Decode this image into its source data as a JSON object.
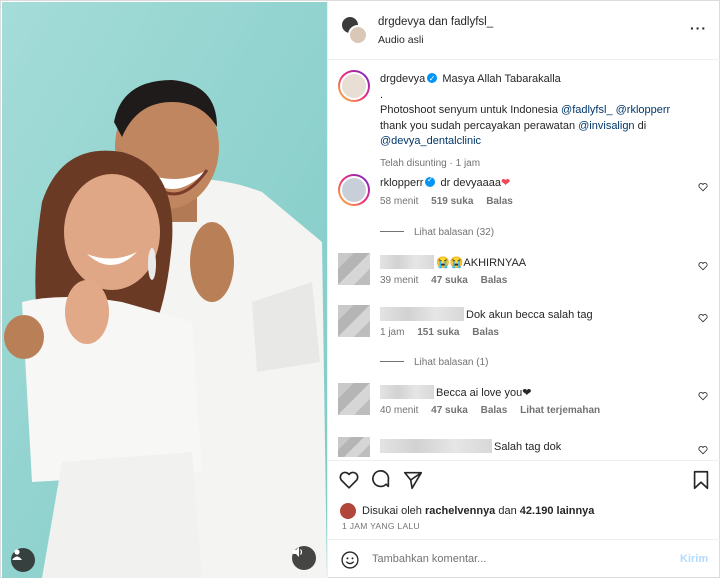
{
  "header": {
    "user1": "drgdevya",
    "joiner": "dan",
    "user2": "fadlyfsl_",
    "audio": "Audio asli",
    "more_icon": "more-icon"
  },
  "caption": {
    "username": "drgdevya",
    "line1": "Masya Allah Tabarakalla",
    "line2": ".",
    "line3_pre": "Photoshoot senyum untuk Indonesia",
    "mention1": "@fadlyfsl_",
    "mention2": "@rklopperr",
    "line4_pre": "thank you sudah percayakan perawatan",
    "mention3": "@invisalign",
    "line4_post": "di",
    "mention4": "@devya_dentalclinic",
    "meta": "Telah disunting · 1 jam"
  },
  "comments": [
    {
      "username": "rklopperr",
      "text": "dr devyaaaa",
      "time": "58 menit",
      "likes": "519 suka",
      "reply": "Balas"
    },
    {
      "text": "😭😭AKHIRNYAA",
      "time": "39 menit",
      "likes": "47 suka",
      "reply": "Balas"
    },
    {
      "text": "Dok akun becca salah tag",
      "time": "1 jam",
      "likes": "151 suka",
      "reply": "Balas"
    },
    {
      "text": "Becca ai love you",
      "time": "40 menit",
      "likes": "47 suka",
      "reply": "Balas",
      "translate": "Lihat terjemahan"
    },
    {
      "text": "Salah tag dok"
    }
  ],
  "view_replies_1": "Lihat balasan (32)",
  "view_replies_2": "Lihat balasan (1)",
  "likes": {
    "prefix": "Disukai oleh",
    "user": "rachelvennya",
    "mid": "dan",
    "count": "42.190",
    "suffix": "lainnya"
  },
  "time_ago": "1 JAM YANG LALU",
  "add_comment": {
    "placeholder": "Tambahkan komentar...",
    "post": "Kirim"
  },
  "colors": {
    "verified": "#0095f6",
    "link": "#00376b",
    "muted": "#737373"
  }
}
